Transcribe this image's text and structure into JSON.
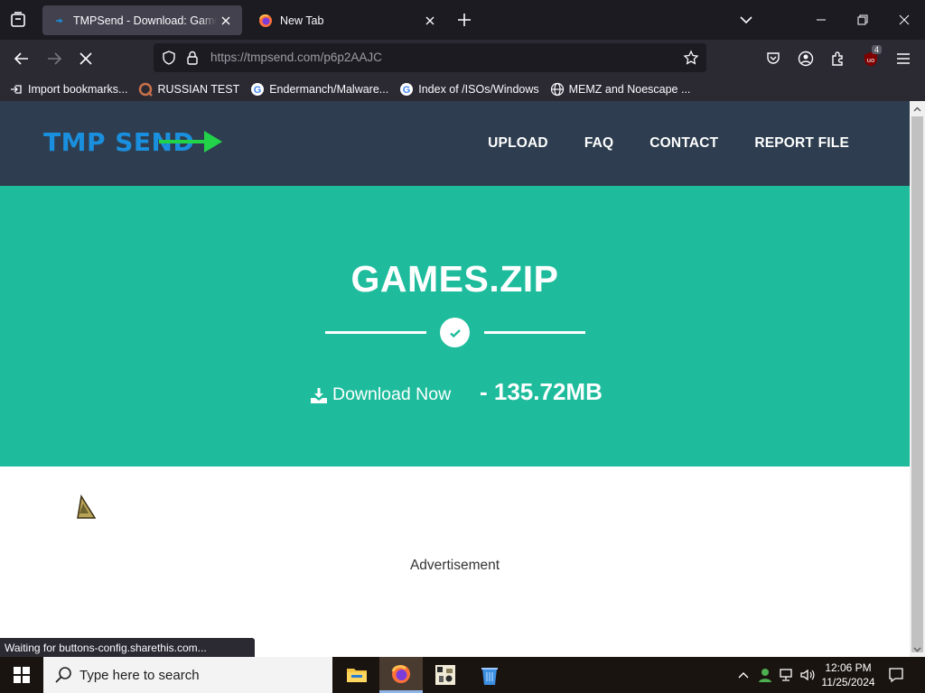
{
  "browser": {
    "tabs": [
      {
        "title": "TMPSend - Download: Games.zip",
        "active": true
      },
      {
        "title": "New Tab",
        "active": false
      }
    ],
    "url": {
      "domain": "https://tmpsend.com",
      "path": "/p6p2AAJC"
    },
    "extension_badge": "4",
    "bookmarks": [
      {
        "label": "Import bookmarks...",
        "icon": "import-icon"
      },
      {
        "label": "RUSSIAN TEST",
        "icon": "russian-test-favicon"
      },
      {
        "label": "Endermanch/Malware...",
        "icon": "google-favicon"
      },
      {
        "label": "Index of /ISOs/Windows",
        "icon": "google-favicon"
      },
      {
        "label": "MEMZ and Noescape ...",
        "icon": "globe-icon"
      }
    ],
    "status_text": "Waiting for buttons-config.sharethis.com..."
  },
  "site": {
    "logo": {
      "text": "TMP SEND",
      "colors": {
        "text": "#1a8fde",
        "arrow": "#22d34a"
      }
    },
    "nav": [
      "UPLOAD",
      "FAQ",
      "CONTACT",
      "REPORT FILE"
    ],
    "file": {
      "name": "GAMES.ZIP",
      "download_label": "Download Now",
      "size": "- 135.72MB"
    },
    "ad_label": "Advertisement",
    "colors": {
      "header": "#2e3e50",
      "hero": "#1ebc9c"
    }
  },
  "taskbar": {
    "search_placeholder": "Type here to search",
    "apps": [
      "file-explorer-icon",
      "firefox-icon",
      "game-app-icon",
      "recycle-bin-icon"
    ],
    "time": "12:06 PM",
    "date": "11/25/2024"
  }
}
